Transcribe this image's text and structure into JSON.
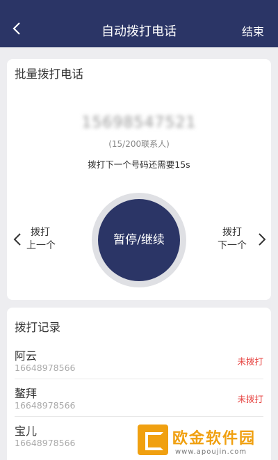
{
  "header": {
    "title": "自动拨打电话",
    "end_label": "结束",
    "bg_color": "#2b3566",
    "back_icon": "chevron-left-icon"
  },
  "dialer": {
    "section_title": "批量拨打电话",
    "current_number": "15698547521",
    "progress": "(15/200联系人)",
    "countdown": "拨打下一个号码还需要15s",
    "main_button": "暂停/继续",
    "prev": {
      "line1": "拨打",
      "line2": "上一个"
    },
    "next": {
      "line1": "拨打",
      "line2": "下一个"
    },
    "accent_color": "#2b3566"
  },
  "records": {
    "section_title": "拨打记录",
    "items": [
      {
        "name": "阿云",
        "phone": "16648978566",
        "status": "未拨打"
      },
      {
        "name": "鳌拜",
        "phone": "16648978566",
        "status": "未拨打"
      },
      {
        "name": "宝儿",
        "phone": "16648978566",
        "status": ""
      }
    ],
    "status_color": "#e64340"
  },
  "watermark": {
    "text": "欧金软件园",
    "url": "www.apoujin.com",
    "color": "#f0a010"
  }
}
